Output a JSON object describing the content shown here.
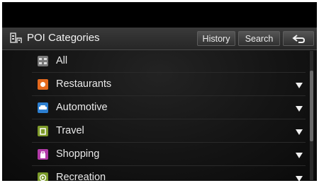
{
  "header": {
    "title": "POI Categories",
    "title_icon": "poi-categories-icon",
    "history_label": "History",
    "search_label": "Search",
    "back_icon": "back-arrow-icon"
  },
  "categories": [
    {
      "label": "All",
      "icon": "all-icon",
      "color": "#7a7a7a",
      "has_submenu": false
    },
    {
      "label": "Restaurants",
      "icon": "restaurant-icon",
      "color": "#e56a1e",
      "has_submenu": true
    },
    {
      "label": "Automotive",
      "icon": "automotive-icon",
      "color": "#2d7fd0",
      "has_submenu": true
    },
    {
      "label": "Travel",
      "icon": "travel-icon",
      "color": "#7e9a2a",
      "has_submenu": true
    },
    {
      "label": "Shopping",
      "icon": "shopping-icon",
      "color": "#b23aa8",
      "has_submenu": true
    },
    {
      "label": "Recreation",
      "icon": "recreation-icon",
      "color": "#7a9a2a",
      "has_submenu": true
    }
  ]
}
